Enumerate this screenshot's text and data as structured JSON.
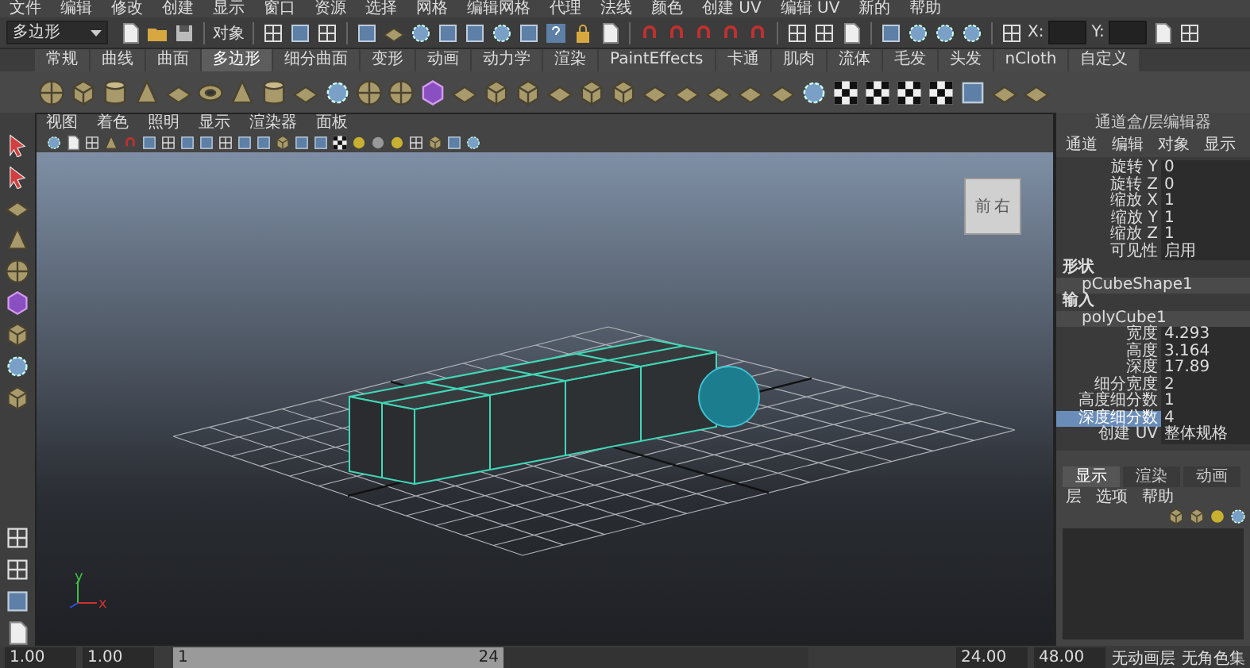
{
  "menu_bar": [
    "文件",
    "编辑",
    "修改",
    "创建",
    "显示",
    "窗口",
    "资源",
    "选择",
    "网格",
    "编辑网格",
    "代理",
    "法线",
    "颜色",
    "创建 UV",
    "编辑 UV",
    "新的",
    "帮助"
  ],
  "status_line": {
    "mode_dropdown": "多边形",
    "selection_label": "对象",
    "x_label": "X:",
    "y_label": "Y:"
  },
  "shelf_tabs": [
    {
      "label": "常规",
      "selected": false
    },
    {
      "label": "曲线",
      "selected": false
    },
    {
      "label": "曲面",
      "selected": false
    },
    {
      "label": "多边形",
      "selected": true
    },
    {
      "label": "细分曲面",
      "selected": false
    },
    {
      "label": "变形",
      "selected": false
    },
    {
      "label": "动画",
      "selected": false
    },
    {
      "label": "动力学",
      "selected": false
    },
    {
      "label": "渲染",
      "selected": false
    },
    {
      "label": "PaintEffects",
      "selected": false
    },
    {
      "label": "卡通",
      "selected": false
    },
    {
      "label": "肌肉",
      "selected": false
    },
    {
      "label": "流体",
      "selected": false
    },
    {
      "label": "毛发",
      "selected": false
    },
    {
      "label": "头发",
      "selected": false
    },
    {
      "label": "nCloth",
      "selected": false
    },
    {
      "label": "自定义",
      "selected": false
    }
  ],
  "viewport": {
    "menu": [
      "视图",
      "着色",
      "照明",
      "显示",
      "渲染器",
      "面板"
    ],
    "view_cube": [
      "前",
      "右"
    ],
    "axis_labels": [
      "y",
      "x"
    ]
  },
  "channel_box": {
    "title": "通道盒/层编辑器",
    "menu": [
      "通道",
      "编辑",
      "对象",
      "显示"
    ],
    "rows": [
      {
        "kind": "attr",
        "label": "旋转 Y",
        "value": "0",
        "selected": false
      },
      {
        "kind": "attr",
        "label": "旋转 Z",
        "value": "0",
        "selected": false
      },
      {
        "kind": "attr",
        "label": "缩放 X",
        "value": "1",
        "selected": false
      },
      {
        "kind": "attr",
        "label": "缩放 Y",
        "value": "1",
        "selected": false
      },
      {
        "kind": "attr",
        "label": "缩放 Z",
        "value": "1",
        "selected": false
      },
      {
        "kind": "attr",
        "label": "可见性",
        "value": "启用",
        "selected": false
      },
      {
        "kind": "section",
        "label": "形状"
      },
      {
        "kind": "node",
        "label": "pCubeShape1"
      },
      {
        "kind": "section",
        "label": "输入"
      },
      {
        "kind": "node",
        "label": "polyCube1"
      },
      {
        "kind": "attr",
        "label": "宽度",
        "value": "4.293",
        "selected": false
      },
      {
        "kind": "attr",
        "label": "高度",
        "value": "3.164",
        "selected": false
      },
      {
        "kind": "attr",
        "label": "深度",
        "value": "17.89",
        "selected": false
      },
      {
        "kind": "attr",
        "label": "细分宽度",
        "value": "2",
        "selected": false
      },
      {
        "kind": "attr",
        "label": "高度细分数",
        "value": "1",
        "selected": false
      },
      {
        "kind": "attr",
        "label": "深度细分数",
        "value": "4",
        "selected": true
      },
      {
        "kind": "attr",
        "label": "创建 UV",
        "value": "整体规格",
        "selected": false
      }
    ]
  },
  "layer_editor": {
    "tabs": [
      {
        "label": "显示",
        "selected": true
      },
      {
        "label": "渲染",
        "selected": false
      },
      {
        "label": "动画",
        "selected": false
      }
    ],
    "menu": [
      "层",
      "选项",
      "帮助"
    ]
  },
  "time_bar": {
    "start": "1.00",
    "range_start": "1.00",
    "slider_start": "1",
    "level": 0.52,
    "slider_end": "24",
    "range_end": "24.00",
    "end": "48.00",
    "anim_layer": "无动画层",
    "character_set": "无角色集"
  }
}
